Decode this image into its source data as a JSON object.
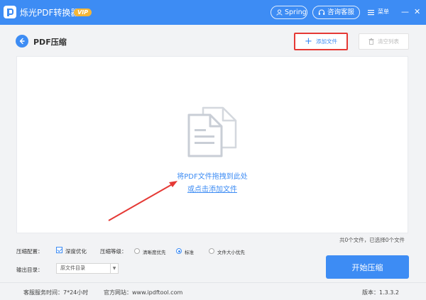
{
  "titlebar": {
    "app_name": "烁光PDF转换器",
    "vip_badge": "VIP",
    "user_name": "Spring",
    "support_label": "咨询客服",
    "menu_label": "菜单",
    "minimize_glyph": "—",
    "close_glyph": "✕",
    "brand_color": "#3d8cf4"
  },
  "header": {
    "page_title": "PDF压缩",
    "add_file_label": "添加文件",
    "add_file_icon": "plus-icon",
    "clear_list_label": "清空列表",
    "clear_list_icon": "trash-icon"
  },
  "dropzone": {
    "hint_line1": "将PDF文件拖拽到此处",
    "hint_line2": "或点击添加文件",
    "icon": "document-icon"
  },
  "file_count_text": "共0个文件，已选择0个文件",
  "settings": {
    "config_label": "压缩配置：",
    "deep_optimize_label": "深度优化",
    "deep_optimize_checked": true,
    "level_label": "压缩等级：",
    "levels": [
      {
        "label": "清晰度优先",
        "selected": false
      },
      {
        "label": "标准",
        "selected": true
      },
      {
        "label": "文件大小优先",
        "selected": false
      }
    ],
    "output_label": "输出目录：",
    "output_value": "原文件目录",
    "start_button_label": "开始压缩"
  },
  "footer": {
    "service_hours": "客服服务时间：7*24小时",
    "website": "官方网站：www.ipdftool.com",
    "version": "版本：1.3.3.2"
  },
  "annotation": {
    "highlight_color": "#e53935"
  }
}
